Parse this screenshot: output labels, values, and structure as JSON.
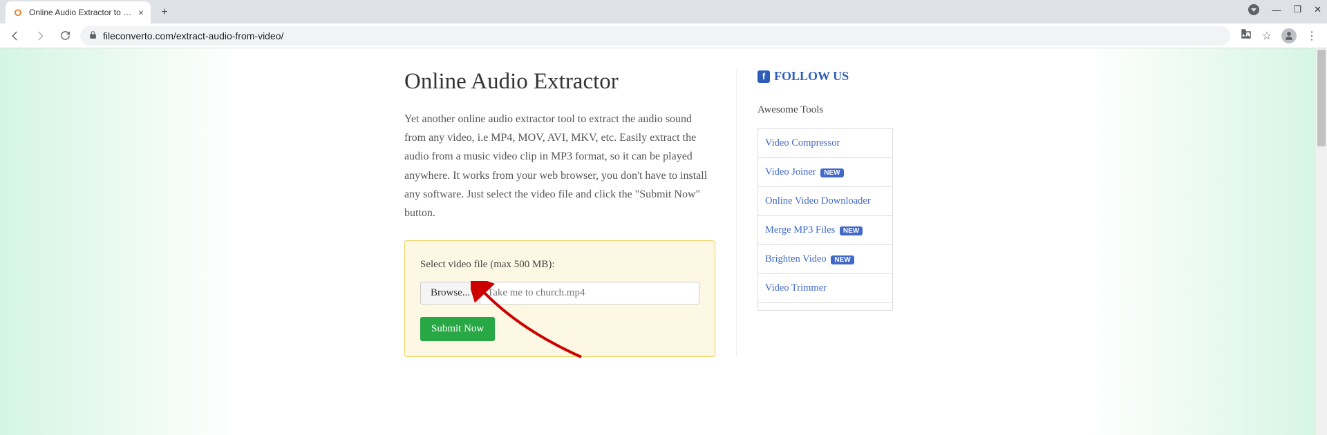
{
  "browser": {
    "tab_title": "Online Audio Extractor to Extr",
    "url": "fileconverto.com/extract-audio-from-video/"
  },
  "main": {
    "heading": "Online Audio Extractor",
    "description": "Yet another online audio extractor tool to extract the audio sound from any video, i.e MP4, MOV, AVI, MKV, etc. Easily extract the audio from a music video clip in MP3 format, so it can be played anywhere. It works from your web browser, you don't have to install any software. Just select the video file and click the \"Submit Now\" button.",
    "upload": {
      "label": "Select video file (max 500 MB):",
      "browse": "Browse...",
      "filename": "Take me to church.mp4",
      "submit": "Submit Now"
    }
  },
  "sidebar": {
    "follow": "FOLLOW US",
    "tools_heading": "Awesome Tools",
    "new_label": "NEW",
    "tools": [
      {
        "label": "Video Compressor",
        "new": false
      },
      {
        "label": "Video Joiner",
        "new": true
      },
      {
        "label": "Online Video Downloader",
        "new": false
      },
      {
        "label": "Merge MP3 Files",
        "new": true
      },
      {
        "label": "Brighten Video",
        "new": true
      },
      {
        "label": "Video Trimmer",
        "new": false
      }
    ]
  }
}
